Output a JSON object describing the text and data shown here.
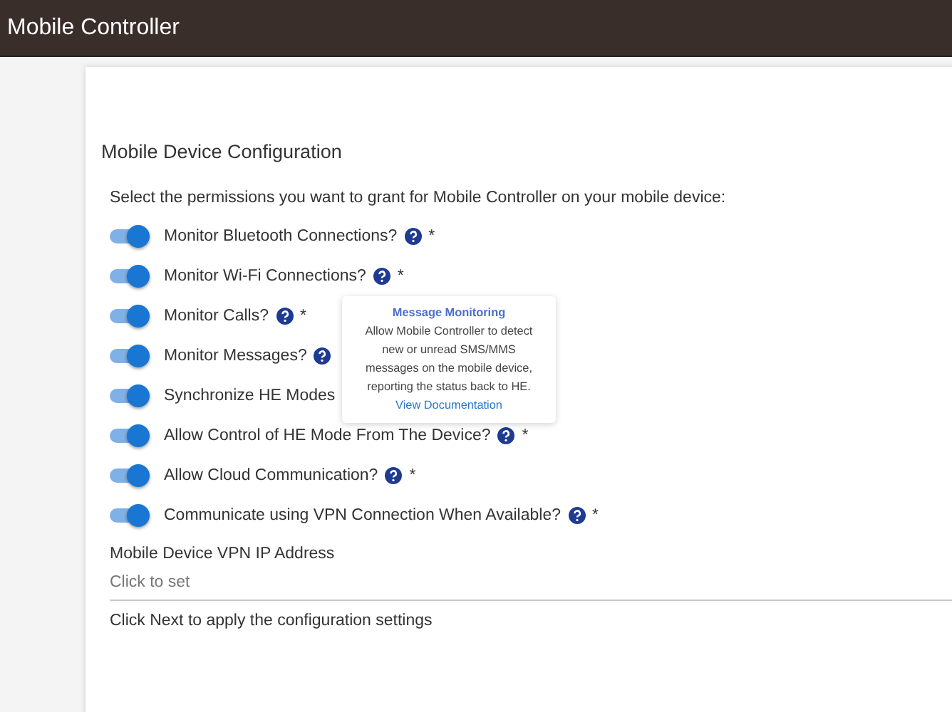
{
  "app_bar": {
    "title": "Mobile Controller"
  },
  "section": {
    "title": "Mobile Device Configuration",
    "intro": "Select the permissions you want to grant for Mobile Controller on your mobile device:"
  },
  "permissions": [
    {
      "label": "Monitor Bluetooth Connections?",
      "on": true,
      "help": true,
      "marker": "*"
    },
    {
      "label": "Monitor Wi-Fi Connections?",
      "on": true,
      "help": true,
      "marker": "*"
    },
    {
      "label": "Monitor Calls?",
      "on": true,
      "help": true,
      "marker": "*"
    },
    {
      "label": "Monitor Messages?",
      "on": true,
      "help": true
    },
    {
      "label": "Synchronize HE Modes",
      "on": true,
      "help": false
    },
    {
      "label": "Allow Control of HE Mode From The Device?",
      "on": true,
      "help": true,
      "marker": "*"
    },
    {
      "label": "Allow Cloud Communication?",
      "on": true,
      "help": true,
      "marker": "*"
    },
    {
      "label": "Communicate using VPN Connection When Available?",
      "on": true,
      "help": true,
      "marker": "*"
    }
  ],
  "tooltip": {
    "title": "Message Monitoring",
    "body": "Allow Mobile Controller to detect new or unread SMS/MMS messages on the mobile device, reporting the status back to HE.",
    "link": "View Documentation"
  },
  "vpn_field": {
    "label": "Mobile Device VPN IP Address",
    "placeholder": "Click to set"
  },
  "footer_note": "Click Next to apply the configuration settings"
}
